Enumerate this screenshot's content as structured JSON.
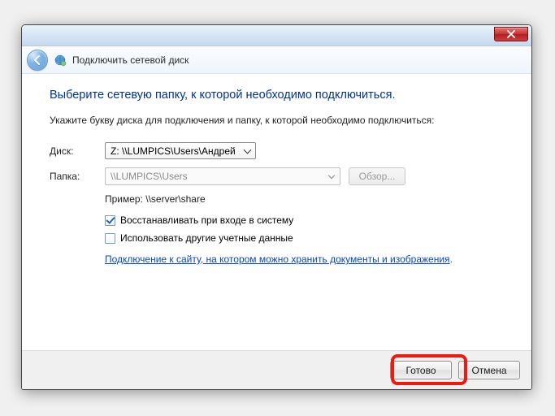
{
  "header": {
    "title": "Подключить сетевой диск"
  },
  "content": {
    "main_title": "Выберите сетевую папку, к которой необходимо подключиться.",
    "instruction": "Укажите букву диска для подключения и папку, к которой необходимо подключиться:",
    "drive_label": "Диск:",
    "drive_value": "Z: \\\\LUMPICS\\Users\\Андрей",
    "folder_label": "Папка:",
    "folder_value": "\\\\LUMPICS\\Users",
    "browse_label": "Обзор...",
    "example_text": "Пример: \\\\server\\share",
    "reconnect_label": "Восстанавливать при входе в систему",
    "reconnect_checked": true,
    "other_creds_label": "Использовать другие учетные данные",
    "other_creds_checked": false,
    "link_text": "Подключение к сайту, на котором можно хранить документы и изображения"
  },
  "footer": {
    "primary_label": "Готово",
    "cancel_label": "Отмена"
  }
}
